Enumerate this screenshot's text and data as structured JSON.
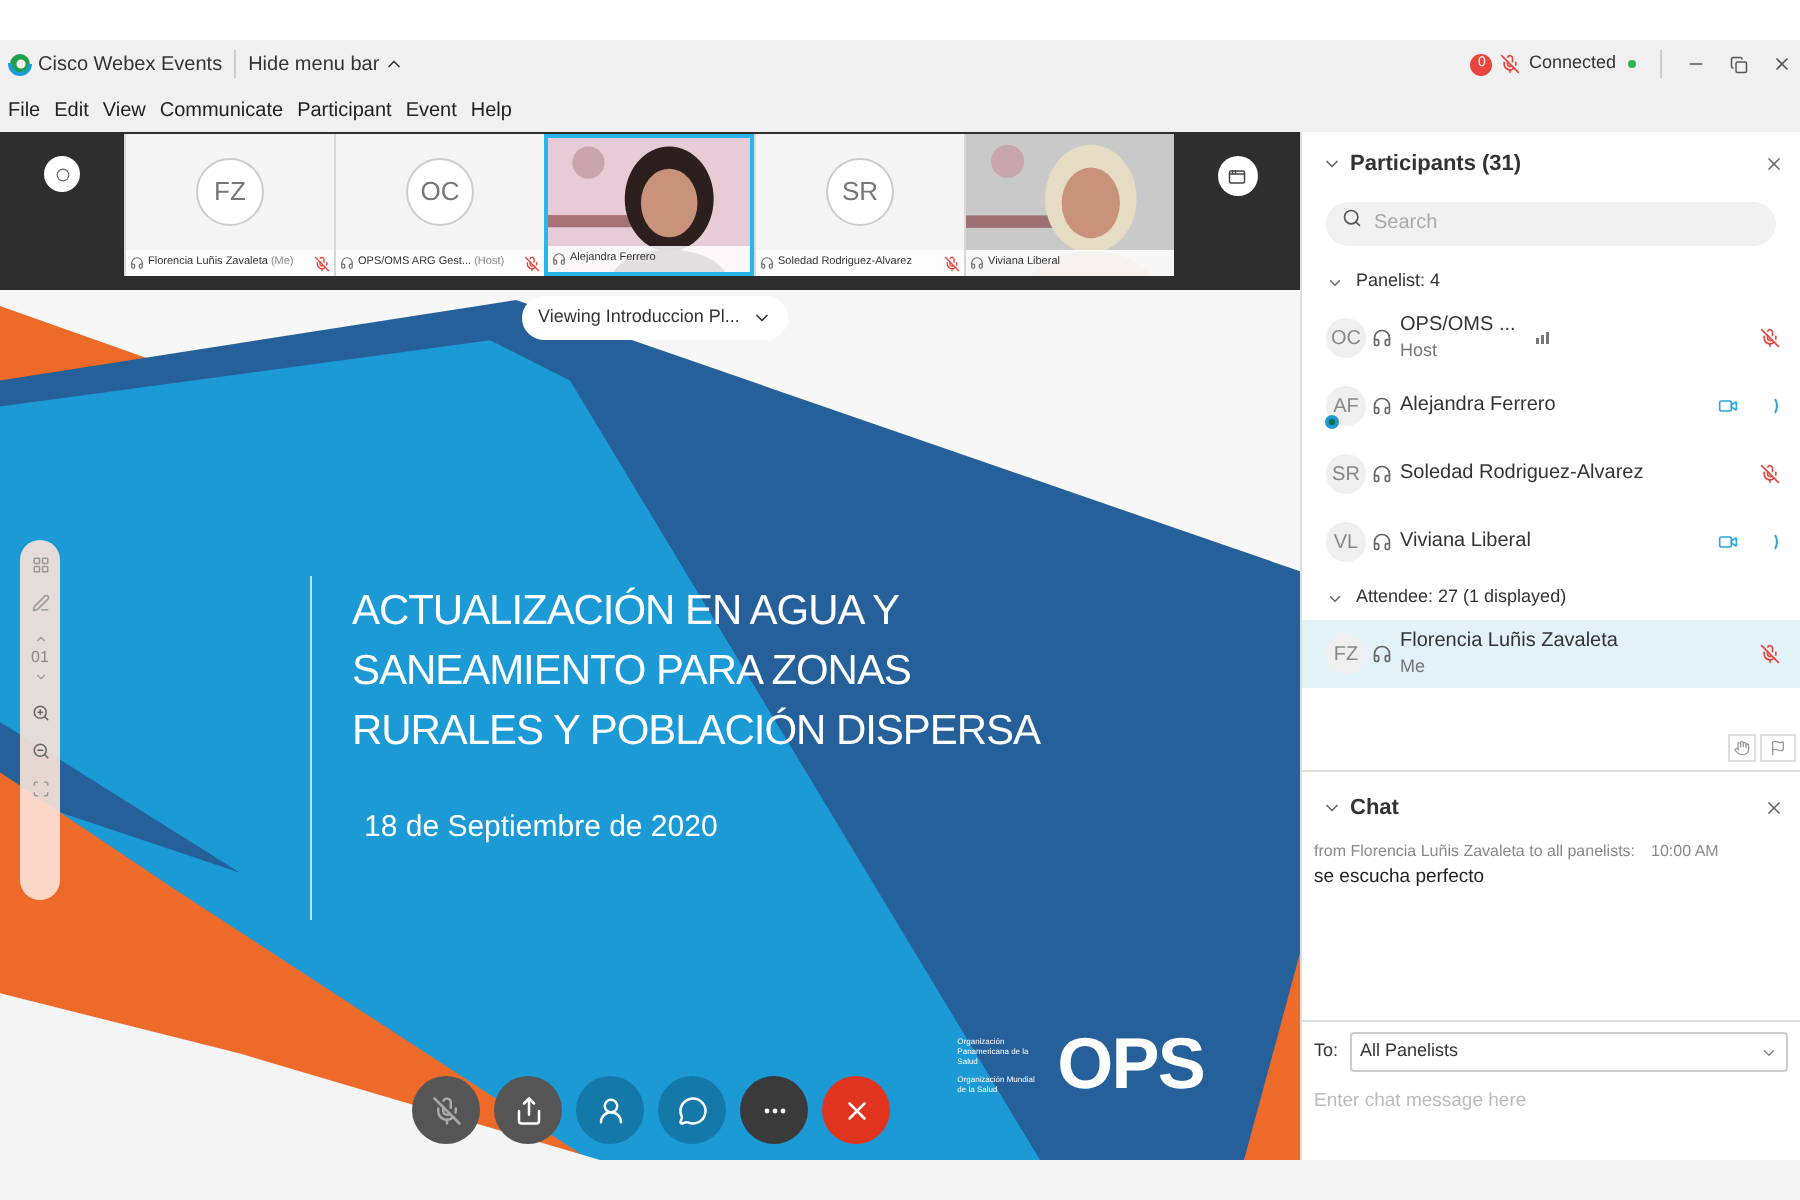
{
  "window": {
    "app_title": "Cisco Webex Events",
    "menu_toggle": "Hide menu bar",
    "recording_count": "0",
    "status": "Connected"
  },
  "menu": [
    "File",
    "Edit",
    "View",
    "Communicate",
    "Participant",
    "Event",
    "Help"
  ],
  "video_tiles": [
    {
      "kind": "avatar",
      "initials": "FZ",
      "name": "Florencia Luñis Zavaleta",
      "role": "(Me)",
      "muted": true,
      "selected": false
    },
    {
      "kind": "avatar",
      "initials": "OC",
      "name": "OPS/OMS ARG Gest...",
      "role": "(Host)",
      "muted": true,
      "selected": false
    },
    {
      "kind": "picture",
      "name": "Alejandra Ferrero",
      "muted": false,
      "selected": true
    },
    {
      "kind": "avatar",
      "initials": "SR",
      "name": "Soledad Rodriguez-Alvarez",
      "muted": true,
      "selected": false
    },
    {
      "kind": "picture",
      "name": "Viviana Liberal",
      "muted": false,
      "selected": false
    }
  ],
  "slide": {
    "viewing": "Viewing Introduccion Pl...",
    "page": "01",
    "title_lines": [
      "ACTUALIZACIÓN EN AGUA Y",
      "SANEAMIENTO PARA ZONAS",
      "RURALES Y POBLACIÓN DISPERSA"
    ],
    "date": "18 de Septiembre de 2020",
    "logo_text": "OPS",
    "logo_lines": [
      "Organización Panamericana de la Salud",
      "Organización Mundial de la Salud"
    ]
  },
  "controls": [
    {
      "kind": "mute"
    },
    {
      "kind": "share"
    },
    {
      "kind": "participants"
    },
    {
      "kind": "chat"
    },
    {
      "kind": "more"
    },
    {
      "kind": "leave"
    }
  ],
  "participants": {
    "title": "Participants (31)",
    "search": {
      "placeholder": "Search"
    },
    "groups": [
      {
        "label": "Panelist: 4",
        "expanded": true,
        "members": [
          {
            "initials": "OC",
            "name": "OPS/OMS ...",
            "subtitle": "Host",
            "muted": true,
            "video": false,
            "audio_active": true,
            "webex_badge": false,
            "selected": false
          },
          {
            "initials": "AF",
            "name": "Alejandra Ferrero",
            "muted": false,
            "video": true,
            "audio_active": false,
            "webex_badge": true,
            "selected": false
          },
          {
            "initials": "SR",
            "name": "Soledad Rodriguez-Alvarez",
            "muted": true,
            "video": false,
            "audio_active": false,
            "webex_badge": false,
            "selected": false
          },
          {
            "initials": "VL",
            "name": "Viviana Liberal",
            "muted": false,
            "video": true,
            "audio_active": false,
            "webex_badge": false,
            "selected": false
          }
        ]
      },
      {
        "label": "Attendee: 27 (1 displayed)",
        "expanded": true,
        "members": [
          {
            "initials": "FZ",
            "name": "Florencia Luñis Zavaleta",
            "subtitle": "Me",
            "muted": true,
            "video": false,
            "audio_active": false,
            "webex_badge": false,
            "selected": true
          }
        ]
      }
    ]
  },
  "chat": {
    "title": "Chat",
    "messages": [
      {
        "from": "from Florencia Luñis Zavaleta to all panelists:",
        "time": "10:00 AM",
        "text": "se escucha perfecto"
      }
    ],
    "to_label": "To:",
    "recipient": "All Panelists",
    "placeholder": "Enter chat message here"
  }
}
